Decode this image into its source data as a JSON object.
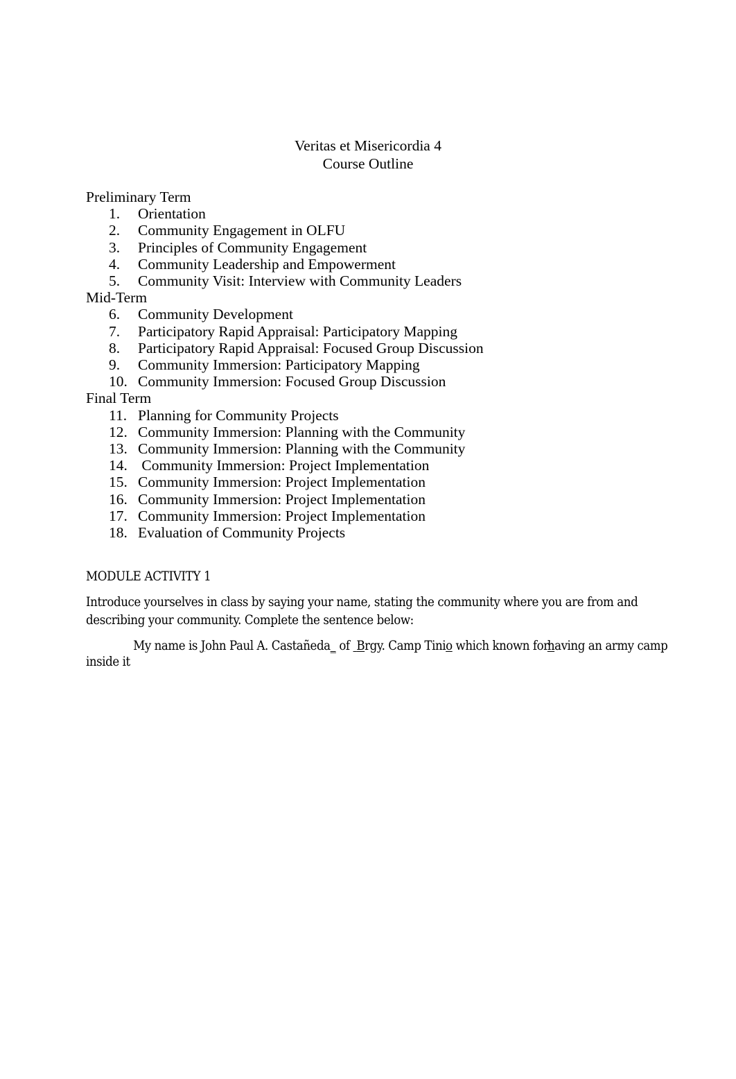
{
  "document": {
    "title_lines": [
      "Veritas et Misericordia 4",
      "Course Outline"
    ],
    "sections": [
      {
        "heading": "Preliminary Term",
        "items": [
          {
            "number": "1.",
            "text": "Orientation"
          },
          {
            "number": "2.",
            "text": "Community Engagement in OLFU"
          },
          {
            "number": "3.",
            "text": "Principles of Community Engagement"
          },
          {
            "number": "4.",
            "text": "Community Leadership and Empowerment"
          },
          {
            "number": "5.",
            "text": "Community Visit: Interview with Community Leaders"
          }
        ]
      },
      {
        "heading": "Mid-Term",
        "items": [
          {
            "number": "6.",
            "text": "Community Development"
          },
          {
            "number": "7.",
            "text": "Participatory Rapid Appraisal: Participatory Mapping"
          },
          {
            "number": "8.",
            "text": "Participatory Rapid Appraisal: Focused Group Discussion"
          },
          {
            "number": "9.",
            "text": "Community Immersion: Participatory Mapping"
          },
          {
            "number": "10.",
            "text": "Community Immersion: Focused Group Discussion"
          }
        ]
      },
      {
        "heading": "Final Term",
        "items": [
          {
            "number": "11.",
            "text": "Planning for Community Projects"
          },
          {
            "number": "12.",
            "text": "Community Immersion: Planning with the Community"
          },
          {
            "number": "13.",
            "text": "Community Immersion: Planning with the Community"
          },
          {
            "number": "14.",
            "text": " Community Immersion: Project Implementation"
          },
          {
            "number": "15.",
            "text": "Community Immersion: Project Implementation"
          },
          {
            "number": "16.",
            "text": "Community Immersion: Project Implementation"
          },
          {
            "number": "17.",
            "text": "Community Immersion: Project Implementation"
          },
          {
            "number": "18.",
            "text": "Evaluation of Community Projects"
          }
        ]
      }
    ],
    "activity": {
      "heading": "MODULE ACTIVITY 1",
      "instructions": "Introduce yourselves in class by saying your name, stating the community where you are from and describing your community. Complete the sentence below:",
      "answer": {
        "lead_in": "My name is ",
        "name_first_char": "J",
        "name_rest": "ohn Paul A. Castañeda",
        "name_trailing_underscore": "_",
        "between_name_and_place": " of ",
        "place_leading_underscore": " ",
        "place_first_char": "B",
        "place_rest": "rgy. Camp Tini",
        "place_last_char": "o",
        "after_place": " which known fo",
        "overlap_r": "r",
        "desc_first_char": "h",
        "desc_rest": "aving an army camp",
        "second_line": "inside it"
      }
    }
  }
}
